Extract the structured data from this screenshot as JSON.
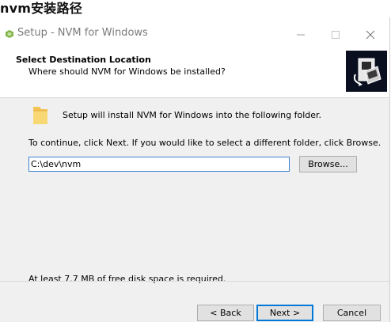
{
  "caption": "nvm安装路径",
  "window": {
    "title": "Setup - NVM for Windows"
  },
  "header": {
    "title": "Select Destination Location",
    "subtitle": "Where should NVM for Windows be installed?"
  },
  "content": {
    "intro": "Setup will install NVM for Windows into the following folder.",
    "instruction": "To continue, click Next. If you would like to select a different folder, click Browse.",
    "path_value": "C:\\dev\\nvm",
    "browse_label": "Browse...",
    "disk_space": "At least 7.7 MB of free disk space is required."
  },
  "buttons": {
    "back": "< Back",
    "next": "Next >",
    "cancel": "Cancel"
  },
  "icons": {
    "app": "nvm-app-icon",
    "logo": "installer-logo-icon",
    "folder": "folder-icon",
    "minimize": "minimize-icon",
    "maximize": "maximize-icon",
    "close": "close-icon"
  },
  "colors": {
    "focus_border": "#0078d7",
    "logo_background": "#0a0f1f",
    "window_background": "#f0f0f0"
  }
}
